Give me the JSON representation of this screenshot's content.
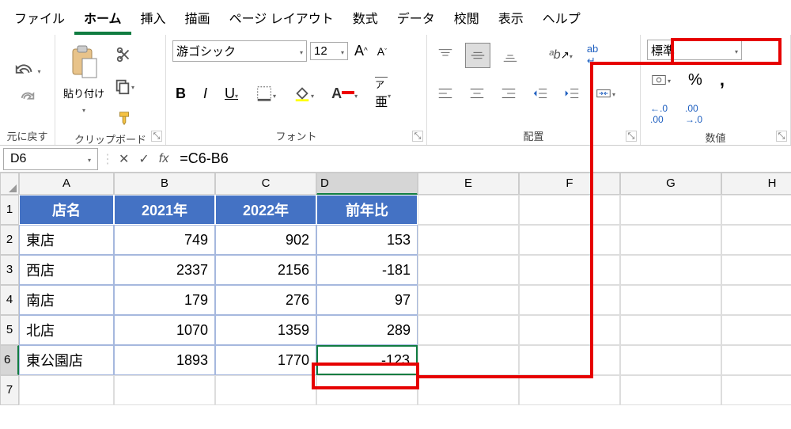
{
  "menu": [
    "ファイル",
    "ホーム",
    "挿入",
    "描画",
    "ページ レイアウト",
    "数式",
    "データ",
    "校閲",
    "表示",
    "ヘルプ"
  ],
  "menu_active": 1,
  "ribbon": {
    "undo_label": "元に戻す",
    "clipboard_label": "クリップボード",
    "paste_label": "貼り付け",
    "font_label": "フォント",
    "font_name": "游ゴシック",
    "font_size": "12",
    "align_label": "配置",
    "number_label": "数値",
    "number_format": "標準",
    "bold": "B",
    "italic": "I",
    "underline": "U"
  },
  "fbar": {
    "name": "D6",
    "formula": "=C6-B6"
  },
  "cols": [
    "A",
    "B",
    "C",
    "D",
    "E",
    "F",
    "G",
    "H"
  ],
  "active_col": 3,
  "rows": [
    1,
    2,
    3,
    4,
    5,
    6,
    7
  ],
  "active_row": 5,
  "header": [
    "店名",
    "2021年",
    "2022年",
    "前年比"
  ],
  "data": [
    [
      "東店",
      "749",
      "902",
      "153"
    ],
    [
      "西店",
      "2337",
      "2156",
      "-181"
    ],
    [
      "南店",
      "179",
      "276",
      "97"
    ],
    [
      "北店",
      "1070",
      "1359",
      "289"
    ],
    [
      "東公園店",
      "1893",
      "1770",
      "-123"
    ]
  ],
  "chart_data": {
    "type": "table",
    "columns": [
      "店名",
      "2021年",
      "2022年",
      "前年比"
    ],
    "rows": [
      [
        "東店",
        749,
        902,
        153
      ],
      [
        "西店",
        2337,
        2156,
        -181
      ],
      [
        "南店",
        179,
        276,
        97
      ],
      [
        "北店",
        1070,
        1359,
        289
      ],
      [
        "東公園店",
        1893,
        1770,
        -123
      ]
    ]
  }
}
